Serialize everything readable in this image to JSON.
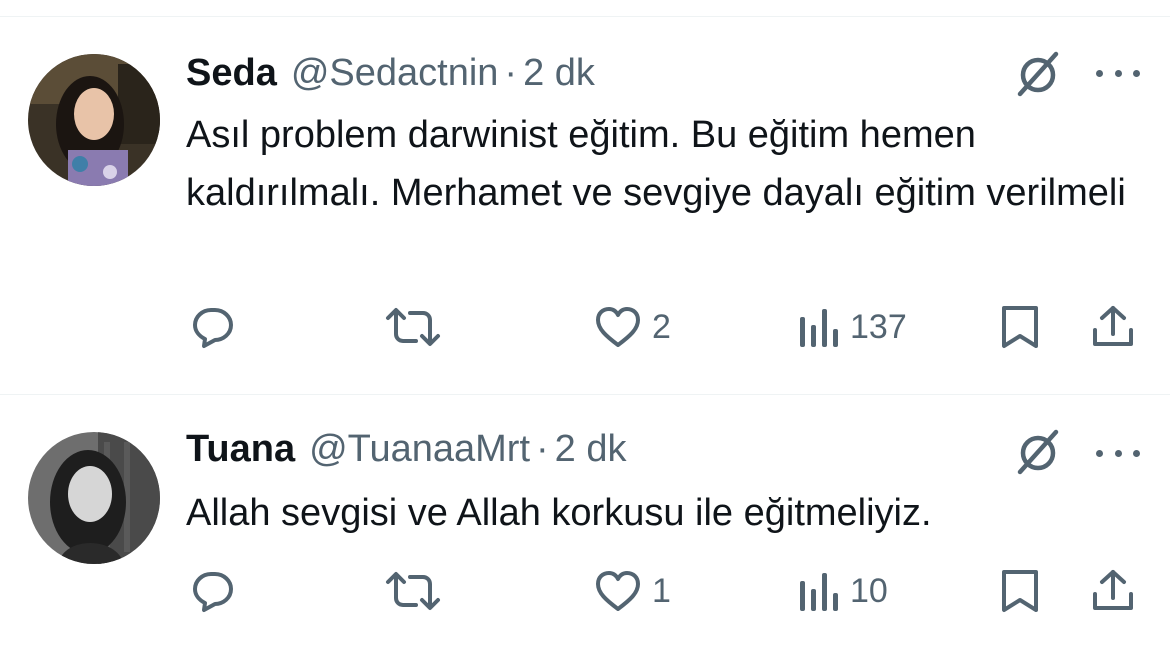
{
  "tweets": [
    {
      "name": "Seda",
      "handle": "@Sedactnin",
      "separator": "·",
      "time": "2 dk",
      "text": "Asıl problem darwinist eğitim. Bu eğitim hemen kaldırılmalı. Merhamet ve sevgiye dayalı eğitim verilmeli",
      "likes": "2",
      "views": "137"
    },
    {
      "name": "Tuana",
      "handle": "@TuanaaMrt",
      "separator": "·",
      "time": "2 dk",
      "text": "Allah sevgisi ve Allah korkusu ile eğitmeliyiz.",
      "likes": "1",
      "views": "10"
    }
  ],
  "icons": {
    "reply": "reply-icon",
    "retweet": "retweet-icon",
    "like": "heart-icon",
    "views": "views-icon",
    "bookmark": "bookmark-icon",
    "share": "share-icon",
    "grok": "grok-icon",
    "more": "more-icon"
  },
  "colors": {
    "text": "#0f1419",
    "secondary": "#536471",
    "divider": "#eff3f4"
  }
}
